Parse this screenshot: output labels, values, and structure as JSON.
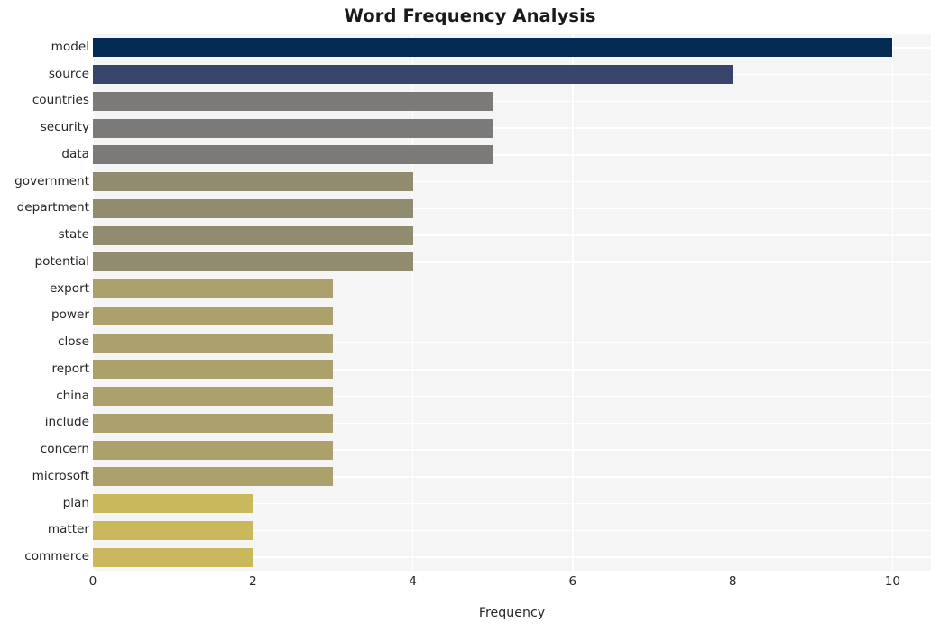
{
  "chart_data": {
    "type": "bar",
    "orientation": "horizontal",
    "title": "Word Frequency Analysis",
    "xlabel": "Frequency",
    "ylabel": "",
    "xlim": [
      0,
      10.48
    ],
    "xticks": [
      0,
      2,
      4,
      6,
      8,
      10
    ],
    "xtick_labels": [
      "0",
      "2",
      "4",
      "6",
      "8",
      "10"
    ],
    "grid": true,
    "grid_axis": "both",
    "legend": null,
    "categories": [
      "model",
      "source",
      "countries",
      "security",
      "data",
      "government",
      "department",
      "state",
      "potential",
      "export",
      "power",
      "close",
      "report",
      "china",
      "include",
      "concern",
      "microsoft",
      "plan",
      "matter",
      "commerce"
    ],
    "values": [
      10,
      8,
      5,
      5,
      5,
      4,
      4,
      4,
      4,
      3,
      3,
      3,
      3,
      3,
      3,
      3,
      3,
      2,
      2,
      2
    ],
    "bar_colors": [
      "#042b54",
      "#37446b",
      "#7c7a78",
      "#7c7a78",
      "#7c7a78",
      "#918b70",
      "#918b70",
      "#918b70",
      "#918b70",
      "#aca06d",
      "#aca06d",
      "#aca06d",
      "#aca06d",
      "#aca06d",
      "#aca06d",
      "#aca06d",
      "#aca06d",
      "#c9b85c",
      "#c9b85c",
      "#c9b85c"
    ],
    "style": {
      "figure_background": "#ffffff",
      "axes_background": "#f5f5f6",
      "grid_color": "#ffffff",
      "text_color": "#262626",
      "title_color": "#1a1a1a"
    }
  }
}
